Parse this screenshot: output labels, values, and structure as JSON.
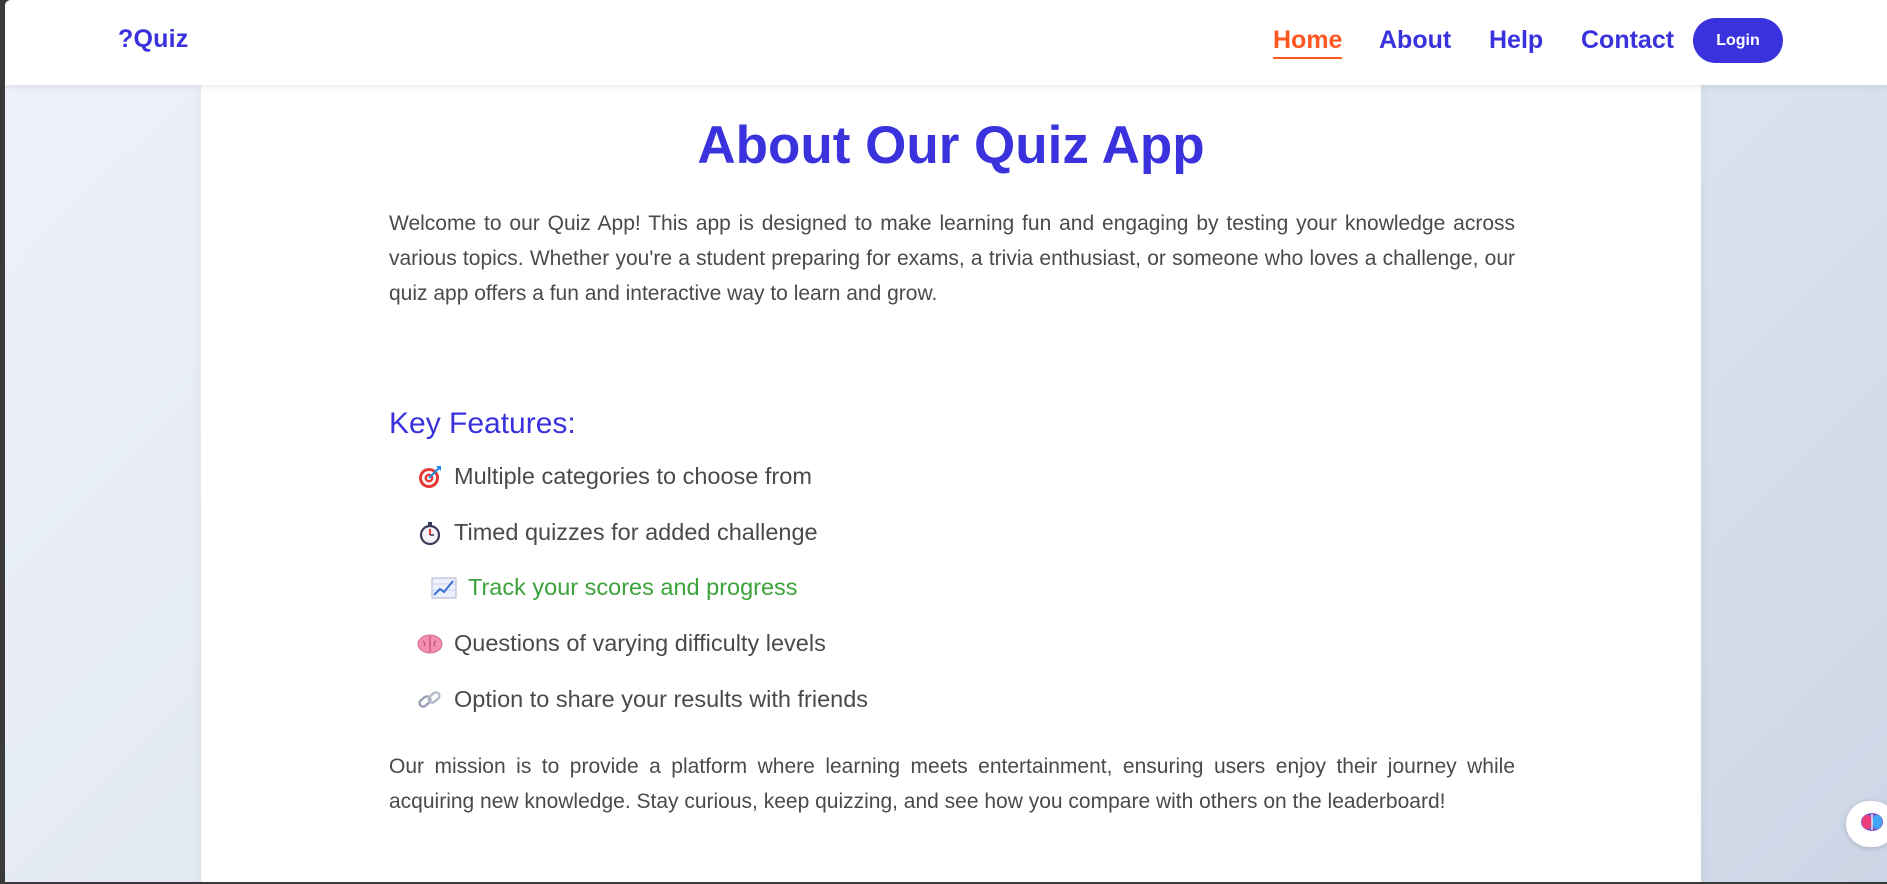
{
  "nav": {
    "brand": "?Quiz",
    "links": [
      {
        "label": "Home",
        "active": true
      },
      {
        "label": "About",
        "active": false
      },
      {
        "label": "Help",
        "active": false
      },
      {
        "label": "Contact",
        "active": false
      }
    ],
    "login_label": "Login"
  },
  "about": {
    "title": "About Our Quiz App",
    "intro": "Welcome to our Quiz App! This app is designed to make learning fun and engaging by testing your knowledge across various topics. Whether you're a student preparing for exams, a trivia enthusiast, or someone who loves a challenge, our quiz app offers a fun and interactive way to learn and grow.",
    "features_heading": "Key Features:",
    "features": [
      {
        "icon": "target-icon",
        "text": "Multiple categories to choose from"
      },
      {
        "icon": "stopwatch-icon",
        "text": "Timed quizzes for added challenge"
      },
      {
        "icon": "chart-increasing-icon",
        "text": "Track your scores and progress"
      },
      {
        "icon": "brain-icon",
        "text": "Questions of varying difficulty levels"
      },
      {
        "icon": "link-icon",
        "text": "Option to share your results with friends"
      }
    ],
    "mission": "Our mission is to provide a platform where learning meets entertainment, ensuring users enjoy their journey while acquiring new knowledge. Stay curious, keep quizzing, and see how you compare with others on the leaderboard!"
  },
  "colors": {
    "brand": "#3a33dd",
    "active_nav": "#ff5722",
    "highlight_feature": "#3ba33a",
    "body_text": "#4a4a4a"
  },
  "floating_widget": {
    "icon": "brain-icon"
  }
}
